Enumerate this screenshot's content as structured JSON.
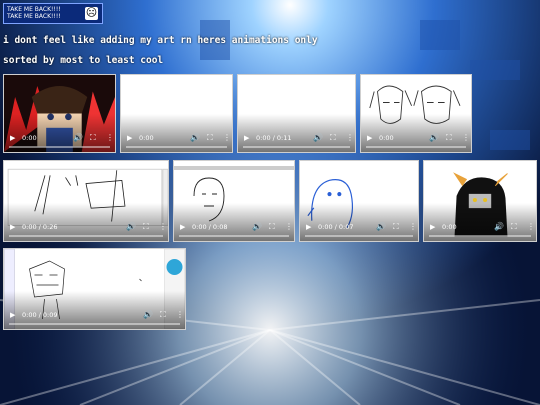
{
  "back_button": {
    "lines": [
      "TAKE ME BACK!!!!",
      "TAKE ME BACK!!!!"
    ],
    "face": "☹"
  },
  "captions": {
    "line1": "i dont feel like adding my art rn heres animations only",
    "line2": "sorted by most to least cool"
  },
  "colors": {
    "background": "#0a1a3a",
    "button_bg": "#0b2a7a",
    "button_border": "#7fa4ff"
  },
  "videos": [
    {
      "time": "0:00",
      "thumb": "red-character"
    },
    {
      "time": "0:00",
      "thumb": "blank"
    },
    {
      "time": "0:00 / 0:11",
      "thumb": "blank"
    },
    {
      "time": "0:00",
      "thumb": "sketch-two-faces"
    },
    {
      "time": "0:00 / 0:26",
      "thumb": "canvas-sketch"
    },
    {
      "time": "0:00 / 0:08",
      "thumb": "face-sketch"
    },
    {
      "time": "0:00 / 0:07",
      "thumb": "blue-sketch"
    },
    {
      "time": "0:00",
      "thumb": "dark-character"
    },
    {
      "time": "0:00 / 0:09",
      "thumb": "editor-sketch"
    }
  ]
}
